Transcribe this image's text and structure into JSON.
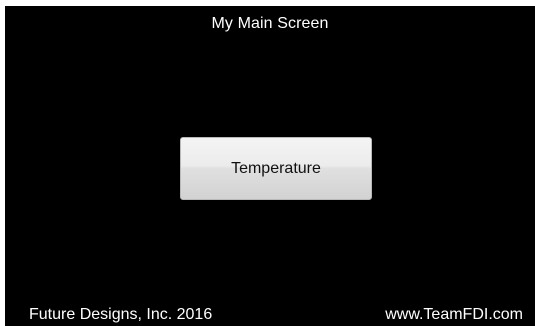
{
  "screen": {
    "title": "My Main Screen",
    "background_color": "#000000",
    "text_color": "#ffffff"
  },
  "buttons": {
    "temperature_label": "Temperature"
  },
  "footer": {
    "company": "Future Designs, Inc. 2016",
    "website": "www.TeamFDI.com"
  }
}
